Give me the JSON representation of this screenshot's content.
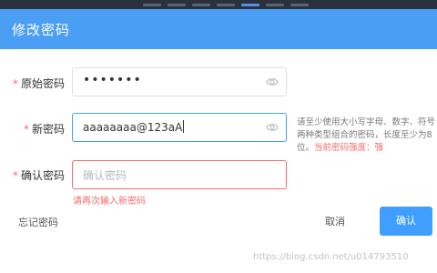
{
  "dialog": {
    "title": "修改密码"
  },
  "form": {
    "old_password": {
      "label": "原始密码",
      "value": "•••••••"
    },
    "new_password": {
      "label": "新密码",
      "value": "aaaaaaaa@123aA",
      "hint_text": "请至少使用大小写字母、数字、符号两种类型组合的密码，长度至少为8位。",
      "strength_label": "当前密码强度：",
      "strength_value": "强"
    },
    "confirm_password": {
      "label": "确认密码",
      "placeholder": "确认密码",
      "error": "请再次输入新密码"
    },
    "required_mark": "*"
  },
  "footer": {
    "forgot_link": "忘记密码",
    "cancel_label": "取消",
    "confirm_label": "确认"
  },
  "watermark": "https://blog.csdn.net/u014793510"
}
